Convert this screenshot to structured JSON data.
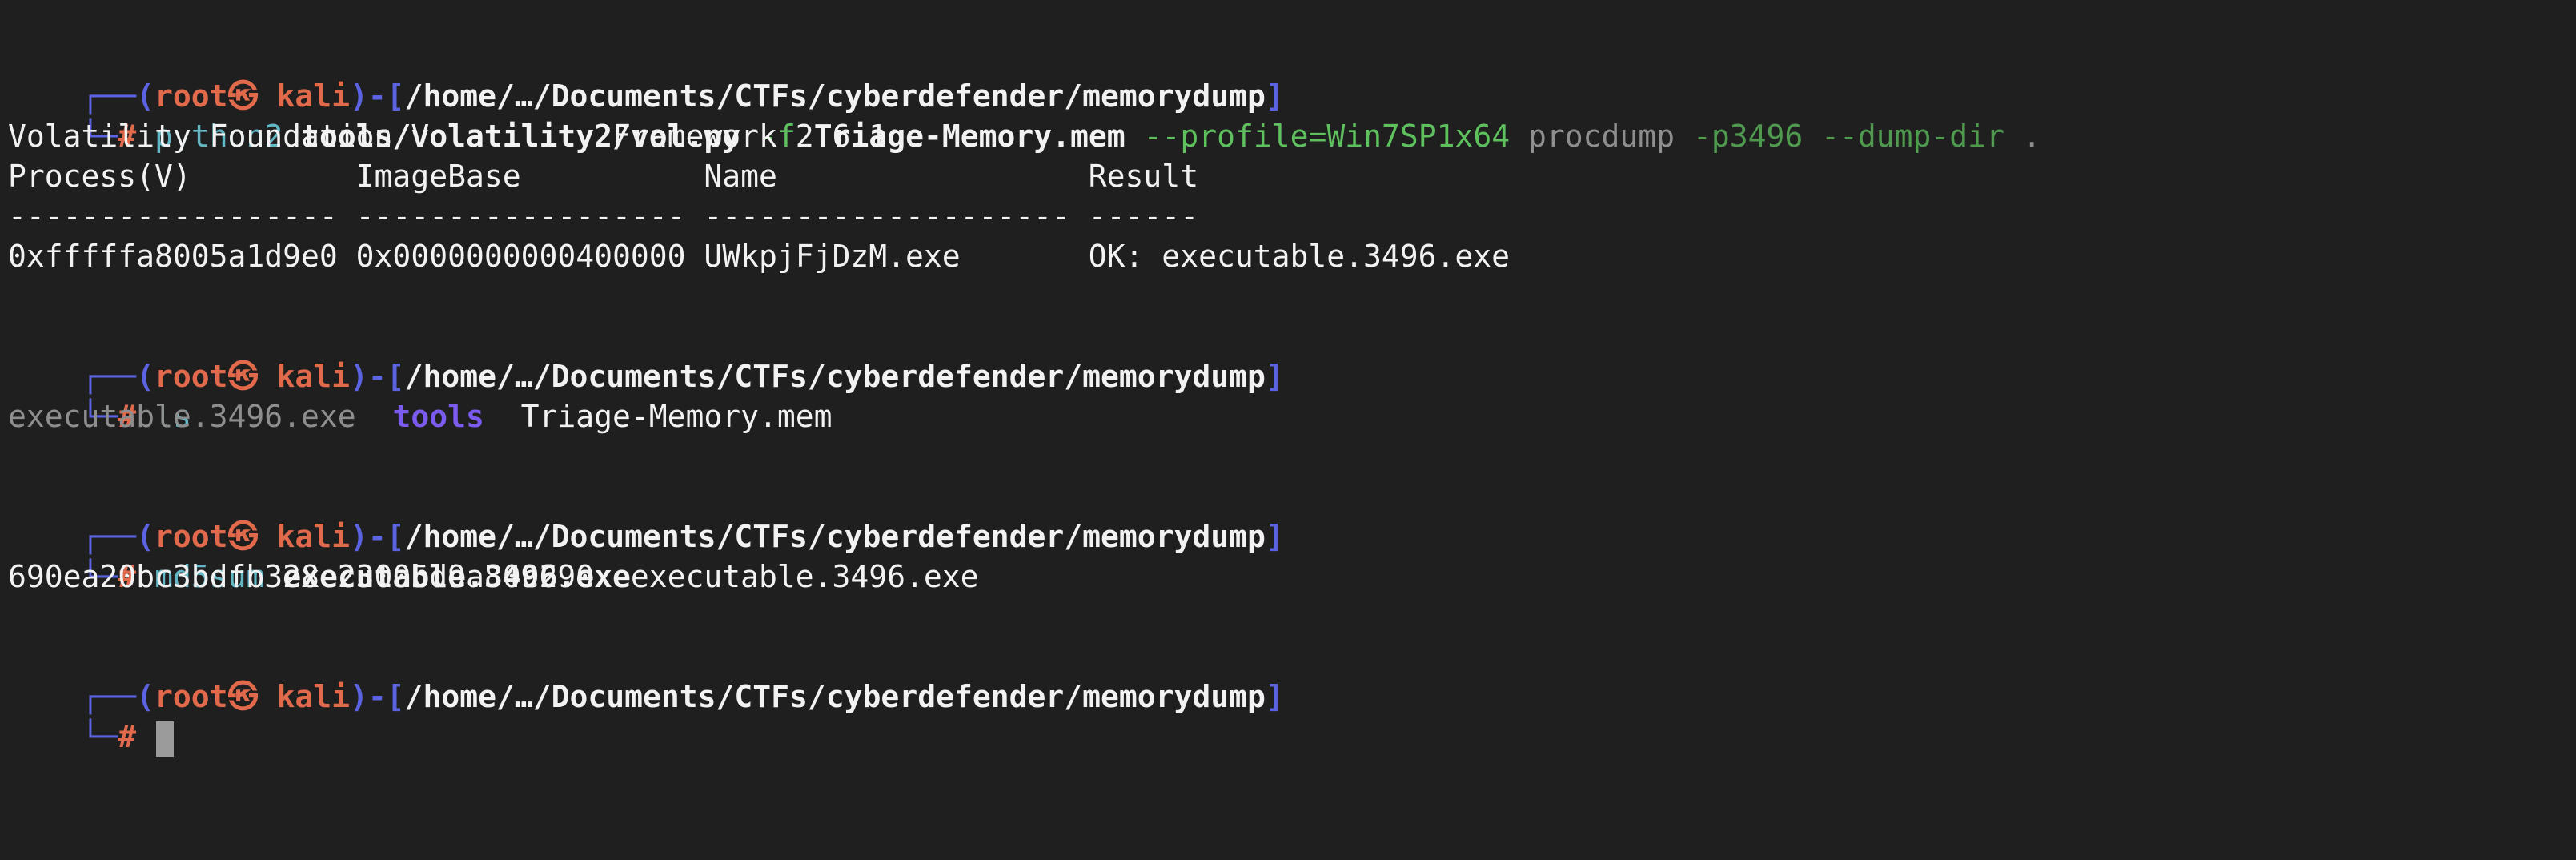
{
  "prompt": {
    "user": "root",
    "skull": "㉿",
    "host": "kali",
    "path": "/home/…/Documents/CTFs/cyberdefender/memorydump",
    "hash": "#"
  },
  "commands": [
    {
      "tokens": [
        {
          "text": "python2",
          "style": "teal"
        },
        {
          "text": " ",
          "style": "white"
        },
        {
          "text": "tools/volatility2/vol.py",
          "style": "white bold"
        },
        {
          "text": " ",
          "style": "white"
        },
        {
          "text": "-f",
          "style": "green"
        },
        {
          "text": " ",
          "style": "white"
        },
        {
          "text": "Triage-Memory.mem",
          "style": "white bold"
        },
        {
          "text": " ",
          "style": "white"
        },
        {
          "text": "--profile=Win7SP1x64",
          "style": "green"
        },
        {
          "text": " ",
          "style": "white"
        },
        {
          "text": "procdump",
          "style": "gray"
        },
        {
          "text": " ",
          "style": "white"
        },
        {
          "text": "-p3496",
          "style": "dimgreen"
        },
        {
          "text": " ",
          "style": "white"
        },
        {
          "text": "--dump-dir",
          "style": "dimgreen"
        },
        {
          "text": " ",
          "style": "white"
        },
        {
          "text": ".",
          "style": "gray"
        }
      ],
      "output": [
        "Volatility Foundation Volatility Framework 2.6.1",
        "Process(V)         ImageBase          Name                 Result",
        "------------------ ------------------ -------------------- ------",
        "0xfffffa8005a1d9e0 0x0000000000400000 UWkpjFjDzM.exe       OK: executable.3496.exe"
      ]
    },
    {
      "tokens": [
        {
          "text": "ls",
          "style": "teal"
        }
      ],
      "ls_output": [
        {
          "text": "executable.3496.exe",
          "style": "gray"
        },
        {
          "text": "  ",
          "style": "white"
        },
        {
          "text": "tools",
          "style": "dir bold"
        },
        {
          "text": "  ",
          "style": "white"
        },
        {
          "text": "Triage-Memory.mem",
          "style": "white"
        }
      ]
    },
    {
      "tokens": [
        {
          "text": "md5sum",
          "style": "teal"
        },
        {
          "text": " ",
          "style": "white"
        },
        {
          "text": "executable.3496.exe",
          "style": "white bold"
        }
      ],
      "output": [
        "690ea20bc3bdfb328e23005d9a80c290  executable.3496.exe"
      ]
    }
  ],
  "colors": {
    "background": "#1f1f1f",
    "prompt_frame": "#5b63e3",
    "prompt_user": "#e06a4b",
    "command": "#63b8c6",
    "option": "#5ec15e",
    "directory": "#7b5bf0"
  }
}
